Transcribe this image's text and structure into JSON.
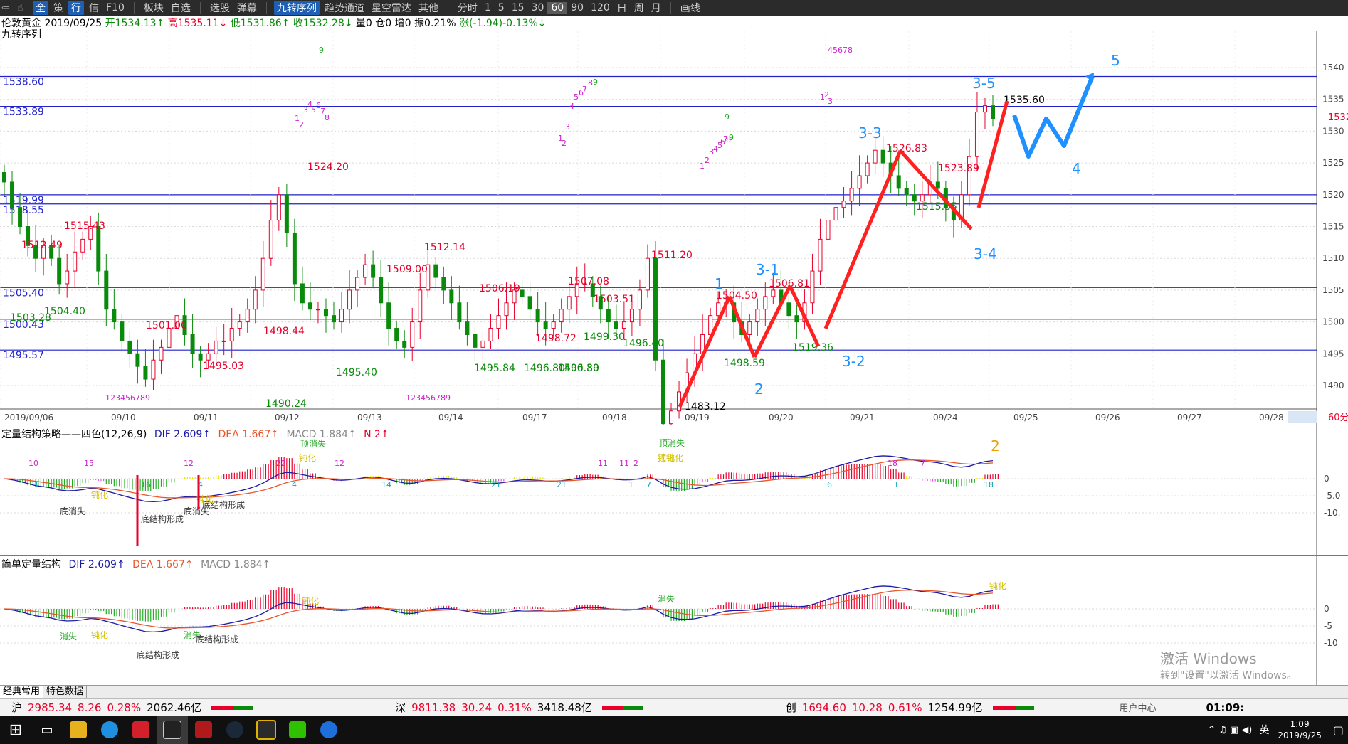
{
  "toolbar": {
    "items": [
      "全",
      "策",
      "行",
      "信",
      "F10",
      "板块",
      "自选",
      "选股",
      "弹幕",
      "九转序列",
      "趋势通道",
      "星空雷达",
      "其他",
      "分时",
      "1",
      "5",
      "15",
      "30",
      "60",
      "90",
      "120",
      "日",
      "周",
      "月",
      "画线"
    ],
    "active_index": 9,
    "selected_period": "60"
  },
  "header": {
    "instrument": "伦敦黄金",
    "date": "2019/09/25",
    "open_label": "开1534.13↑",
    "high_label": "高1535.11↓",
    "low_label": "低1531.86↑",
    "close_label": "收1532.28↓",
    "volume_label": "量0",
    "oi_label": "仓0",
    "inc_label": "增0",
    "amp_label": "振0.21%",
    "change_label": "涨(-1.94)-0.13%↓",
    "indicator_name": "九转序列"
  },
  "main_chart": {
    "y_ticks": [
      "1540",
      "1535",
      "1530",
      "1525",
      "1520",
      "1515",
      "1510",
      "1505",
      "1500",
      "1495",
      "1490"
    ],
    "current_price_tag": "1532",
    "period_tag": "60分",
    "x_ticks": [
      "2019/09/06",
      "09/10",
      "09/11",
      "09/12",
      "09/13",
      "09/14",
      "09/17",
      "09/18",
      "09/19",
      "09/20",
      "09/21",
      "09/24",
      "09/25",
      "09/26",
      "09/27",
      "09/28"
    ],
    "levels": [
      "1538.60",
      "1533.89",
      "1519.99",
      "1518.55",
      "1505.40",
      "1500.43",
      "1495.57"
    ],
    "price_labels": {
      "red": [
        "1515.43",
        "1512.49",
        "1501.00",
        "1495.03",
        "1498.44",
        "1524.20",
        "1509.00",
        "1512.14",
        "1506.19",
        "1507.08",
        "1503.51",
        "1498.72",
        "1511.20",
        "1504.50",
        "1506.81",
        "1526.83",
        "1523.89"
      ],
      "green": [
        "1504.40",
        "1503.28",
        "1490.24",
        "1495.40",
        "1495.84",
        "1496.80",
        "1496.80",
        "1500.39",
        "1499.30",
        "1496.40",
        "1498.59",
        "1519.36",
        "1515.55"
      ],
      "black": [
        "1483.12",
        "1535.60"
      ]
    },
    "wave_labels": [
      "1",
      "2",
      "3-1",
      "3-2",
      "3-3",
      "3-4",
      "3-5",
      "4",
      "5"
    ],
    "td_numbers": [
      "9",
      "45678",
      "9",
      "1",
      "2",
      "3",
      "4",
      "5",
      "6",
      "7",
      "8",
      "1",
      "2",
      "3",
      "4",
      "5",
      "6",
      "7",
      "8",
      "9",
      "1",
      "2",
      "3",
      "4",
      "5",
      "6",
      "7",
      "8",
      "9",
      "1",
      "2",
      "3",
      "123456789",
      "123456789"
    ]
  },
  "indicator1": {
    "title": "定量结构策略——四色(12,26,9)",
    "dif_label": "DIF 2.609↑",
    "dea_label": "DEA 1.667↑",
    "macd_label": "MACD 1.884↑",
    "n_label": "N 2↑",
    "y_ticks": [
      "0",
      "-5.0",
      "-10."
    ],
    "annotations": [
      "底消失",
      "底结构形成",
      "底消失",
      "底结构形成",
      "顶消失",
      "顶消失",
      "钝化",
      "钝化",
      "钝化",
      "钝化",
      "顶钝化",
      "2"
    ],
    "counts": [
      "10",
      "15",
      "12",
      "22",
      "1",
      "16",
      "4",
      "4",
      "14",
      "11",
      "21",
      "21",
      "11",
      "1",
      "2",
      "7",
      "12",
      "6",
      "18",
      "1",
      "7",
      "18"
    ]
  },
  "indicator2": {
    "title": "简单定量结构",
    "dif_label": "DIF 2.609↑",
    "dea_label": "DEA 1.667↑",
    "macd_label": "MACD 1.884↑",
    "y_ticks": [
      "0",
      "-5",
      "-10"
    ],
    "annotations": [
      "消失",
      "钝化",
      "底结构形成",
      "消失",
      "底结构形成",
      "钝化",
      "消失",
      "钝化"
    ]
  },
  "tabs": [
    "经典常用",
    "特色数据"
  ],
  "status_bar": {
    "sh": {
      "label": "沪",
      "price": "2985.34",
      "chg": "8.26",
      "pct": "0.28%",
      "amt": "2062.46亿"
    },
    "sz": {
      "label": "深",
      "price": "9811.38",
      "chg": "30.24",
      "pct": "0.31%",
      "amt": "3418.48亿"
    },
    "cy": {
      "label": "创",
      "price": "1694.60",
      "chg": "10.28",
      "pct": "0.61%",
      "amt": "1254.99亿"
    },
    "user_center": "用户中心",
    "clock": "01:09:"
  },
  "watermark": {
    "line1": "激活 Windows",
    "line2": "转到\"设置\"以激活 Windows。"
  },
  "taskbar": {
    "time": "1:09",
    "date": "2019/9/25",
    "ime": "英"
  },
  "colors": {
    "up": "#e8002a",
    "down": "#0a8a0a",
    "blue_wave": "#1e90ff",
    "level": "#2222cc"
  }
}
